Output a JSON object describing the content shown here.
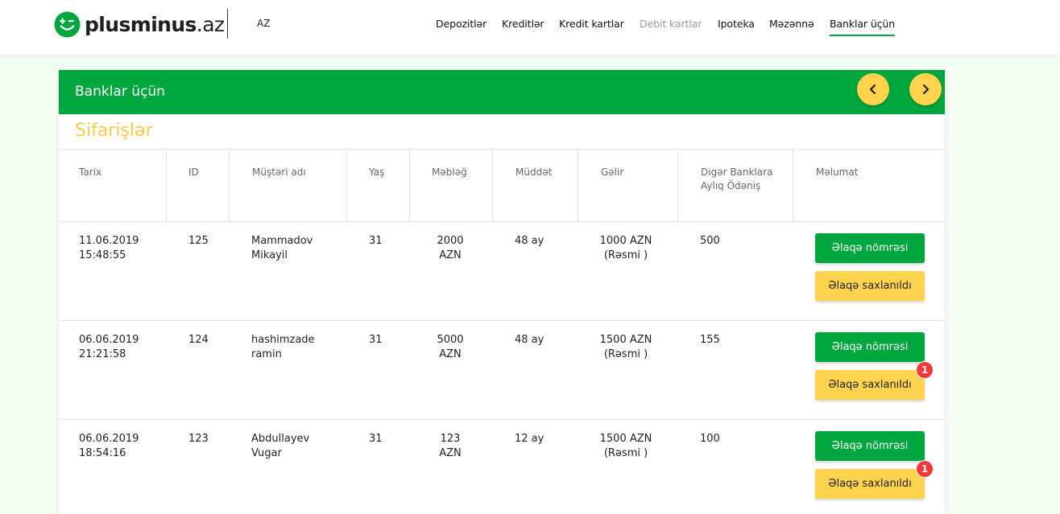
{
  "header": {
    "logo_main": "plusminus",
    "logo_tld": ".az",
    "language": "AZ",
    "nav": [
      {
        "label": "Depozitlər",
        "state": "normal"
      },
      {
        "label": "Kreditlər",
        "state": "normal"
      },
      {
        "label": "Kredit kartlar",
        "state": "normal"
      },
      {
        "label": "Debit kartlar",
        "state": "disabled"
      },
      {
        "label": "Ipoteka",
        "state": "normal"
      },
      {
        "label": "Məzənnə",
        "state": "normal"
      },
      {
        "label": "Banklar üçün",
        "state": "active"
      }
    ]
  },
  "panel": {
    "title": "Banklar üçün",
    "section_title": "Sifarişlər",
    "prev_icon": "chevron-left-icon",
    "next_icon": "chevron-right-icon"
  },
  "table": {
    "columns": [
      "Tarix",
      "ID",
      "Müştəri adı",
      "Yaş",
      "Məbləğ",
      "Müddət",
      "Gəlir",
      "Digər Banklara Aylıq Ödəniş",
      "Məlumat"
    ],
    "rows": [
      {
        "date": "11.06.2019",
        "time": "15:48:55",
        "id": "125",
        "name_first": "Mammadov",
        "name_second": "Mikayil",
        "age": "31",
        "amount": "2000",
        "amount_currency": "AZN",
        "term": "48 ay",
        "income": "1000 AZN",
        "income_type": "(Rəsmi )",
        "other_payments": "500",
        "contact_button": "Əlaqə nömrəsi",
        "saved_button": "Əlaqə saxlanıldı",
        "badge": ""
      },
      {
        "date": "06.06.2019",
        "time": "21:21:58",
        "id": "124",
        "name_first": "hashimzade",
        "name_second": "ramin",
        "age": "31",
        "amount": "5000",
        "amount_currency": "AZN",
        "term": "48 ay",
        "income": "1500 AZN",
        "income_type": "(Rəsmi )",
        "other_payments": "155",
        "contact_button": "Əlaqə nömrəsi",
        "saved_button": "Əlaqə saxlanıldı",
        "badge": "1"
      },
      {
        "date": "06.06.2019",
        "time": "18:54:16",
        "id": "123",
        "name_first": "Abdullayev",
        "name_second": "Vugar",
        "age": "31",
        "amount": "123",
        "amount_currency": "AZN",
        "term": "12 ay",
        "income": "1500 AZN",
        "income_type": "(Rəsmi )",
        "other_payments": "100",
        "contact_button": "Əlaqə nömrəsi",
        "saved_button": "Əlaqə saxlanıldı",
        "badge": "1"
      }
    ]
  },
  "colors": {
    "brand_green": "#00a63e",
    "accent_yellow": "#ffd34e",
    "section_title_yellow": "#ffc84a",
    "badge_red": "#f23838",
    "page_background": "#f2fcf2"
  }
}
